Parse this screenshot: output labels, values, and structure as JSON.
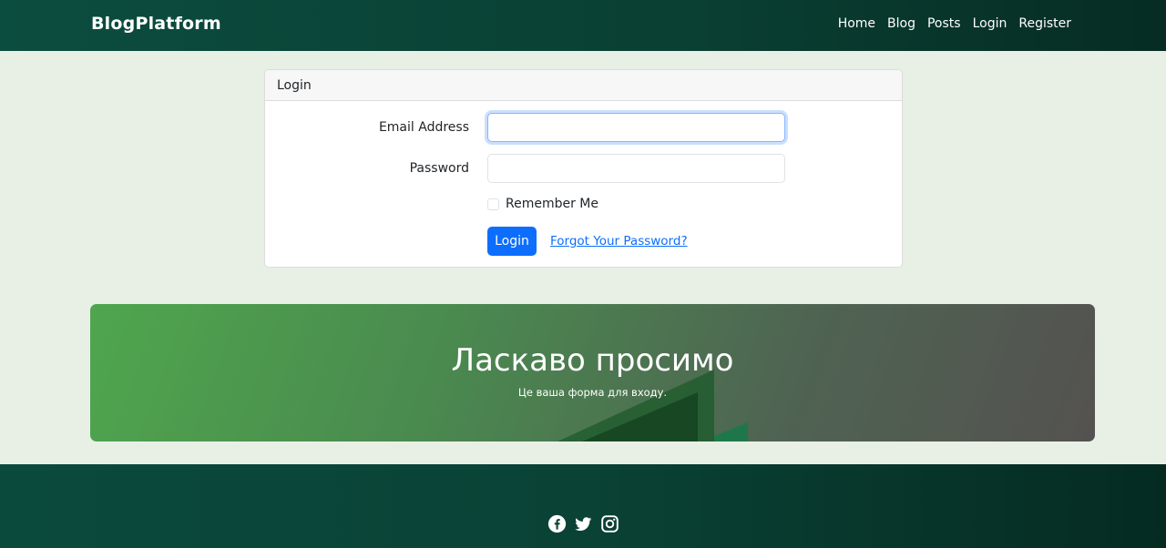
{
  "navbar": {
    "brand": "BlogPlatform",
    "links": [
      "Home",
      "Blog",
      "Posts",
      "Login",
      "Register"
    ]
  },
  "login_card": {
    "header": "Login",
    "email_label": "Email Address",
    "email_value": "",
    "password_label": "Password",
    "password_value": "",
    "remember_label": "Remember Me",
    "remember_checked": false,
    "submit_label": "Login",
    "forgot_label": "Forgot Your Password?"
  },
  "hero": {
    "title": "Ласкаво просимо",
    "subtitle": "Це ваша форма для входу."
  },
  "footer": {
    "social_icons": [
      "facebook-icon",
      "twitter-icon",
      "instagram-icon"
    ]
  },
  "colors": {
    "primary": "#0d6efd",
    "navbar": "#0b4d3f",
    "background": "#e8f0e6"
  }
}
